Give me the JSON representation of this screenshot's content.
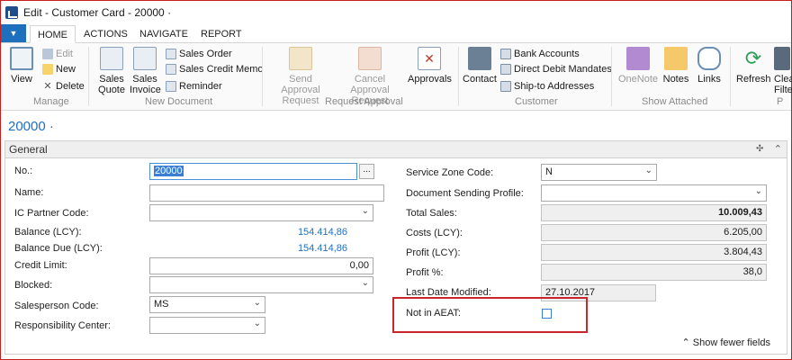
{
  "window": {
    "title": "Edit - Customer Card - 20000 ·"
  },
  "tabs": [
    "HOME",
    "ACTIONS",
    "NAVIGATE",
    "REPORT"
  ],
  "app_menu_icon": "dropdown-arrow",
  "ribbon": {
    "manage": {
      "label": "Manage",
      "view": "View",
      "edit": "Edit",
      "new": "New",
      "delete": "Delete"
    },
    "new_document": {
      "label": "New Document",
      "sales_quote_1": "Sales",
      "sales_quote_2": "Quote",
      "sales_invoice_1": "Sales",
      "sales_invoice_2": "Invoice",
      "sales_order": "Sales Order",
      "sales_credit_memo": "Sales Credit Memo",
      "reminder": "Reminder"
    },
    "request_approval": {
      "label": "Request Approval",
      "send_1": "Send Approval",
      "send_2": "Request",
      "cancel_1": "Cancel Approval",
      "cancel_2": "Request",
      "approvals": "Approvals"
    },
    "customer": {
      "label": "Customer",
      "contact": "Contact",
      "bank_accounts": "Bank Accounts",
      "direct_debit_mandates": "Direct Debit Mandates",
      "ship_to_addresses": "Ship-to Addresses"
    },
    "show_attached": {
      "label": "Show Attached",
      "onenote": "OneNote",
      "notes": "Notes",
      "links": "Links"
    },
    "page": {
      "label": "P",
      "refresh": "Refresh",
      "clear_filter_1": "Clea",
      "clear_filter_2": "Filte"
    }
  },
  "record_title": "20000 ·",
  "general": {
    "title": "General",
    "left": {
      "no_label": "No.:",
      "no_value": "20000",
      "lookup": "...",
      "name_label": "Name:",
      "name_value": "",
      "ic_partner_label": "IC Partner Code:",
      "ic_partner_value": "",
      "balance_label": "Balance (LCY):",
      "balance_value": "154.414,86",
      "balance_due_label": "Balance Due (LCY):",
      "balance_due_value": "154.414,86",
      "credit_limit_label": "Credit Limit:",
      "credit_limit_value": "0,00",
      "blocked_label": "Blocked:",
      "blocked_value": "",
      "salesperson_label": "Salesperson Code:",
      "salesperson_value": "MS",
      "responsibility_label": "Responsibility Center:",
      "responsibility_value": ""
    },
    "right": {
      "service_zone_label": "Service Zone Code:",
      "service_zone_value": "N",
      "doc_sending_label": "Document Sending Profile:",
      "doc_sending_value": "",
      "total_sales_label": "Total Sales:",
      "total_sales_value": "10.009,43",
      "costs_label": "Costs (LCY):",
      "costs_value": "6.205,00",
      "profit_label": "Profit (LCY):",
      "profit_value": "3.804,43",
      "profit_pct_label": "Profit %:",
      "profit_pct_value": "38,0",
      "last_modified_label": "Last Date Modified:",
      "last_modified_value": "27.10.2017",
      "not_in_aeat_label": "Not in AEAT:",
      "not_in_aeat_checked": false
    },
    "show_fewer": "Show fewer fields"
  },
  "colors": {
    "accent": "#1f6fbf",
    "highlight_box": "#c8262a"
  }
}
